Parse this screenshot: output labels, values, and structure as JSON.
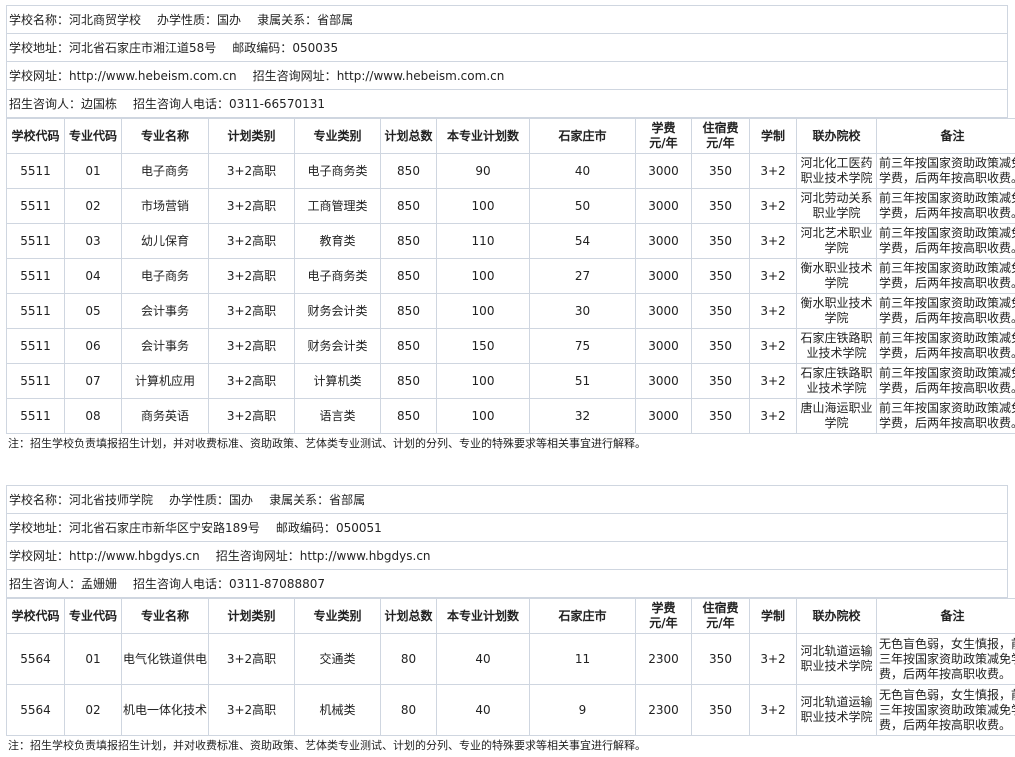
{
  "labels": {
    "school_name": "学校名称：",
    "nature": "办学性质：",
    "affiliation": "隶属关系：",
    "address": "学校地址：",
    "postcode": "邮政编码：",
    "website": "学校网址：",
    "consult_website": "招生咨询网址：",
    "contact": "招生咨询人：",
    "contact_phone": "招生咨询人电话："
  },
  "headers": [
    "学校代码",
    "专业代码",
    "专业名称",
    "计划类别",
    "专业类别",
    "计划总数",
    "本专业计划数",
    "石家庄市",
    "学费\n元/年",
    "住宿费\n元/年",
    "学制",
    "联办院校",
    "备注"
  ],
  "note": "注：招生学校负责填报招生计划，并对收费标准、资助政策、艺体类专业测试、计划的分列、专业的特殊要求等相关事宜进行解释。",
  "schools": [
    {
      "name": "河北商贸学校",
      "nature": "国办",
      "affiliation": "省部属",
      "address": "河北省石家庄市湘江道58号",
      "postcode": "050035",
      "website": "http://www.hebeism.com.cn",
      "consult_website": "http://www.hebeism.com.cn",
      "contact": "边国栋",
      "contact_phone": "0311-66570131",
      "rows": [
        [
          "5511",
          "01",
          "电子商务",
          "3+2高职",
          "电子商务类",
          "850",
          "90",
          "40",
          "3000",
          "350",
          "3+2",
          "河北化工医药职业技术学院",
          "前三年按国家资助政策减免学费，后两年按高职收费。"
        ],
        [
          "5511",
          "02",
          "市场营销",
          "3+2高职",
          "工商管理类",
          "850",
          "100",
          "50",
          "3000",
          "350",
          "3+2",
          "河北劳动关系职业学院",
          "前三年按国家资助政策减免学费，后两年按高职收费。"
        ],
        [
          "5511",
          "03",
          "幼儿保育",
          "3+2高职",
          "教育类",
          "850",
          "110",
          "54",
          "3000",
          "350",
          "3+2",
          "河北艺术职业学院",
          "前三年按国家资助政策减免学费，后两年按高职收费。"
        ],
        [
          "5511",
          "04",
          "电子商务",
          "3+2高职",
          "电子商务类",
          "850",
          "100",
          "27",
          "3000",
          "350",
          "3+2",
          "衡水职业技术学院",
          "前三年按国家资助政策减免学费，后两年按高职收费。"
        ],
        [
          "5511",
          "05",
          "会计事务",
          "3+2高职",
          "财务会计类",
          "850",
          "100",
          "30",
          "3000",
          "350",
          "3+2",
          "衡水职业技术学院",
          "前三年按国家资助政策减免学费，后两年按高职收费。"
        ],
        [
          "5511",
          "06",
          "会计事务",
          "3+2高职",
          "财务会计类",
          "850",
          "150",
          "75",
          "3000",
          "350",
          "3+2",
          "石家庄铁路职业技术学院",
          "前三年按国家资助政策减免学费，后两年按高职收费。"
        ],
        [
          "5511",
          "07",
          "计算机应用",
          "3+2高职",
          "计算机类",
          "850",
          "100",
          "51",
          "3000",
          "350",
          "3+2",
          "石家庄铁路职业技术学院",
          "前三年按国家资助政策减免学费，后两年按高职收费。"
        ],
        [
          "5511",
          "08",
          "商务英语",
          "3+2高职",
          "语言类",
          "850",
          "100",
          "32",
          "3000",
          "350",
          "3+2",
          "唐山海运职业学院",
          "前三年按国家资助政策减免学费，后两年按高职收费。"
        ]
      ]
    },
    {
      "name": "河北省技师学院",
      "nature": "国办",
      "affiliation": "省部属",
      "address": "河北省石家庄市新华区宁安路189号",
      "postcode": "050051",
      "website": "http://www.hbgdys.cn",
      "consult_website": "http://www.hbgdys.cn",
      "contact": "孟姗姗",
      "contact_phone": "0311-87088807",
      "rows": [
        [
          "5564",
          "01",
          "电气化铁道供电",
          "3+2高职",
          "交通类",
          "80",
          "40",
          "11",
          "2300",
          "350",
          "3+2",
          "河北轨道运输职业技术学院",
          "无色盲色弱，女生慎报，前三年按国家资助政策减免学费，后两年按高职收费。"
        ],
        [
          "5564",
          "02",
          "机电一体化技术",
          "3+2高职",
          "机械类",
          "80",
          "40",
          "9",
          "2300",
          "350",
          "3+2",
          "河北轨道运输职业技术学院",
          "无色盲色弱，女生慎报，前三年按国家资助政策减免学费，后两年按高职收费。"
        ]
      ]
    }
  ]
}
